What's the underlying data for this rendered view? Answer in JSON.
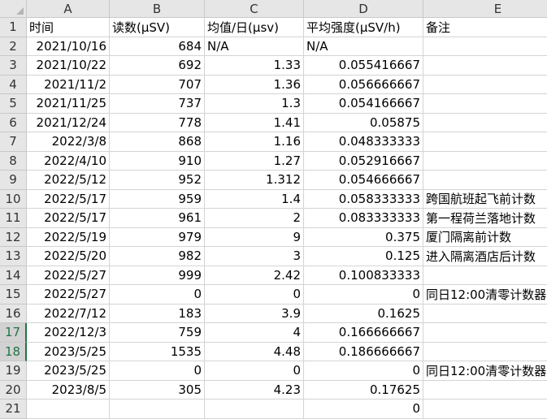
{
  "columns": [
    "A",
    "B",
    "C",
    "D",
    "E"
  ],
  "selected_rows": [
    "17",
    "18"
  ],
  "rows": [
    {
      "n": "1",
      "a": "时间",
      "b": "读数(μSV)",
      "c": "均值/日(μsv)",
      "d": "平均强度(μSV/h)",
      "e": "备注",
      "hdr": true
    },
    {
      "n": "2",
      "a": "2021/10/16",
      "b": "684",
      "c": "N/A",
      "d": "N/A",
      "e": ""
    },
    {
      "n": "3",
      "a": "2021/10/22",
      "b": "692",
      "c": "1.33",
      "d": "0.055416667",
      "e": ""
    },
    {
      "n": "4",
      "a": "2021/11/2",
      "b": "707",
      "c": "1.36",
      "d": "0.056666667",
      "e": ""
    },
    {
      "n": "5",
      "a": "2021/11/25",
      "b": "737",
      "c": "1.3",
      "d": "0.054166667",
      "e": ""
    },
    {
      "n": "6",
      "a": "2021/12/24",
      "b": "778",
      "c": "1.41",
      "d": "0.05875",
      "e": ""
    },
    {
      "n": "7",
      "a": "2022/3/8",
      "b": "868",
      "c": "1.16",
      "d": "0.048333333",
      "e": ""
    },
    {
      "n": "8",
      "a": "2022/4/10",
      "b": "910",
      "c": "1.27",
      "d": "0.052916667",
      "e": ""
    },
    {
      "n": "9",
      "a": "2022/5/12",
      "b": "952",
      "c": "1.312",
      "d": "0.054666667",
      "e": ""
    },
    {
      "n": "10",
      "a": "2022/5/17",
      "b": "959",
      "c": "1.4",
      "d": "0.058333333",
      "e": "跨国航班起飞前计数"
    },
    {
      "n": "11",
      "a": "2022/5/17",
      "b": "961",
      "c": "2",
      "d": "0.083333333",
      "e": "第一程荷兰落地计数"
    },
    {
      "n": "12",
      "a": "2022/5/19",
      "b": "979",
      "c": "9",
      "d": "0.375",
      "e": "厦门隔离前计数"
    },
    {
      "n": "13",
      "a": "2022/5/20",
      "b": "982",
      "c": "3",
      "d": "0.125",
      "e": "进入隔离酒店后计数"
    },
    {
      "n": "14",
      "a": "2022/5/27",
      "b": "999",
      "c": "2.42",
      "d": "0.100833333",
      "e": ""
    },
    {
      "n": "15",
      "a": "2022/5/27",
      "b": "0",
      "c": "0",
      "d": "0",
      "e": "同日12:00清零计数器"
    },
    {
      "n": "16",
      "a": "2022/7/12",
      "b": "183",
      "c": "3.9",
      "d": "0.1625",
      "e": ""
    },
    {
      "n": "17",
      "a": "2022/12/3",
      "b": "759",
      "c": "4",
      "d": "0.166666667",
      "e": ""
    },
    {
      "n": "18",
      "a": "2023/5/25",
      "b": "1535",
      "c": "4.48",
      "d": "0.186666667",
      "e": ""
    },
    {
      "n": "19",
      "a": "2023/5/25",
      "b": "0",
      "c": "0",
      "d": "0",
      "e": "同日12:00清零计数器"
    },
    {
      "n": "20",
      "a": "2023/8/5",
      "b": "305",
      "c": "4.23",
      "d": "0.17625",
      "e": ""
    },
    {
      "n": "21",
      "a": "",
      "b": "",
      "c": "",
      "d": "0",
      "e": ""
    }
  ]
}
